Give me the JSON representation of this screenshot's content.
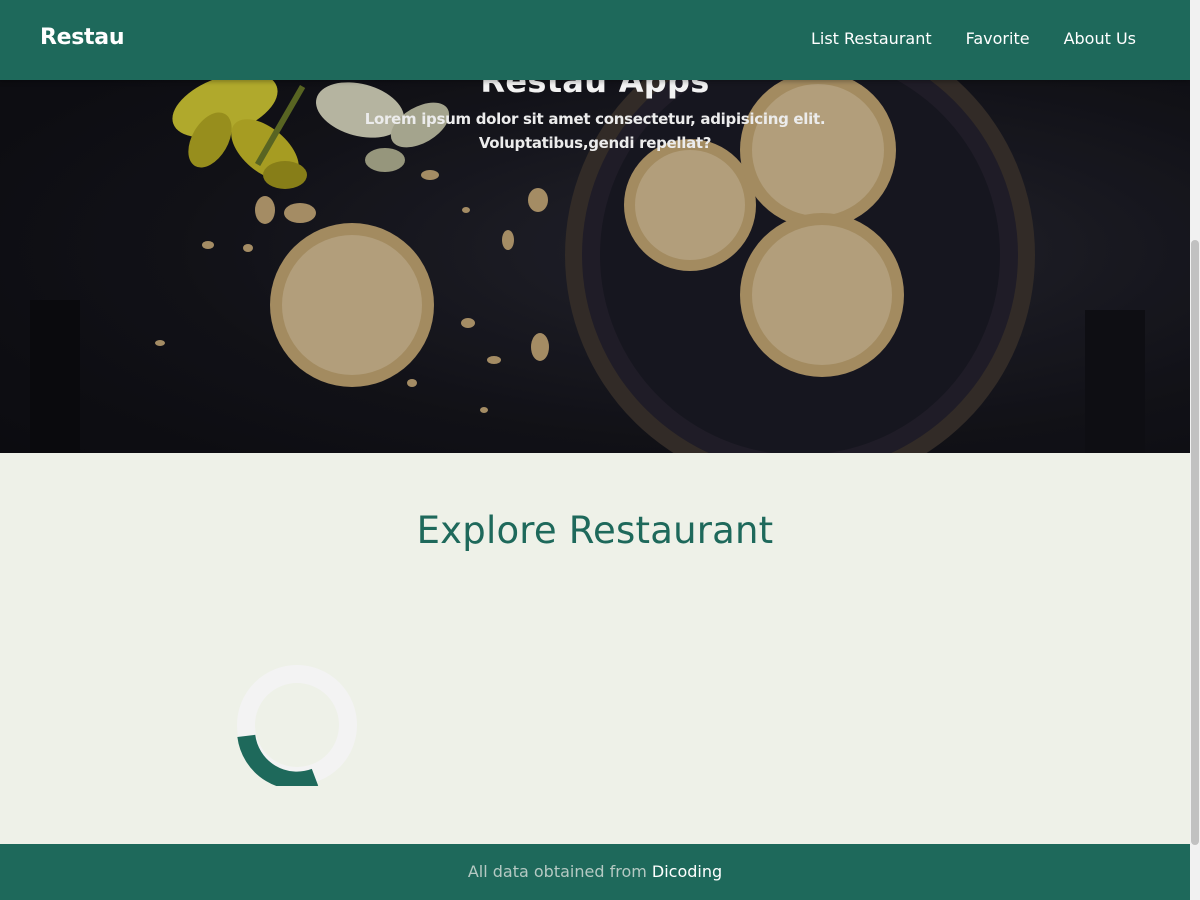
{
  "navbar": {
    "brand": "Restau",
    "links": [
      {
        "label": "List Restaurant"
      },
      {
        "label": "Favorite"
      },
      {
        "label": "About Us"
      }
    ]
  },
  "hero": {
    "title": "Restau Apps",
    "subtitle": "Lorem ipsum dolor sit amet consectetur, adipisicing elit. Voluptatibus,gendi repellat?"
  },
  "main": {
    "heading": "Explore Restaurant"
  },
  "footer": {
    "text": "All data obtained from",
    "link": "Dicoding"
  },
  "colors": {
    "primary": "#1e695b",
    "background": "#eef1e8",
    "loader_track": "#f3f3f3"
  },
  "icons": {
    "loader": "loading-spinner-icon"
  }
}
